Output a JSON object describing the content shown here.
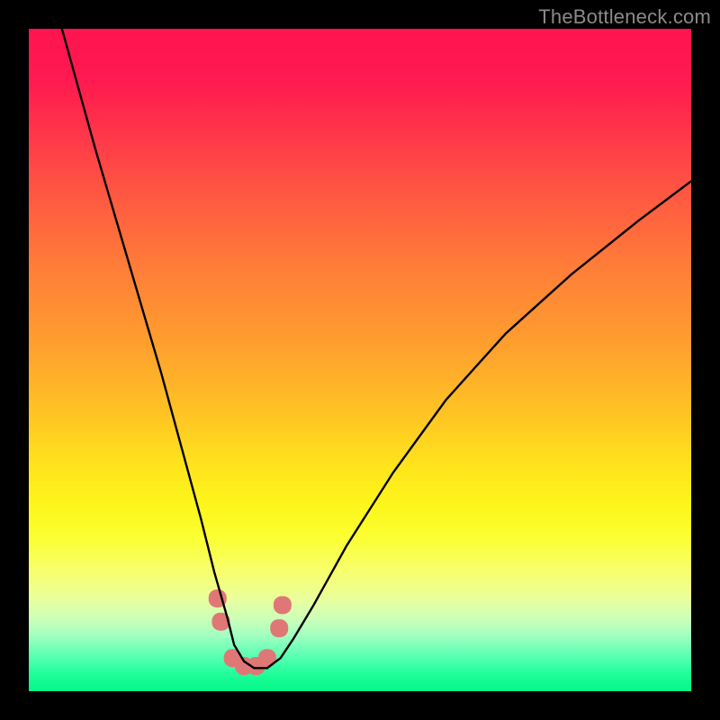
{
  "watermark": {
    "text": "TheBottleneck.com"
  },
  "chart_data": {
    "type": "line",
    "title": "",
    "xlabel": "",
    "ylabel": "",
    "x_range": [
      0,
      100
    ],
    "y_range": [
      0,
      100
    ],
    "grid": false,
    "legend": false,
    "background": {
      "kind": "vertical_gradient",
      "stops": [
        {
          "pct": 0,
          "color": "#ff1450"
        },
        {
          "pct": 50,
          "color": "#ffbd26"
        },
        {
          "pct": 75,
          "color": "#fbff34"
        },
        {
          "pct": 100,
          "color": "#07f78b"
        }
      ]
    },
    "series": [
      {
        "name": "bottleneck_curve",
        "color": "#000000",
        "x": [
          5,
          10,
          15,
          20,
          23,
          26,
          28,
          30,
          31,
          32.5,
          34,
          36,
          38,
          40,
          43,
          48,
          55,
          63,
          72,
          82,
          92,
          100
        ],
        "y": [
          100,
          82,
          65,
          48,
          37,
          26,
          18,
          11,
          7,
          4.5,
          3.5,
          3.5,
          5,
          8,
          13,
          22,
          33,
          44,
          54,
          63,
          71,
          77
        ]
      }
    ],
    "markers": {
      "name": "highlight_points",
      "color": "#e07777",
      "shape": "rounded",
      "x": [
        28.5,
        29.0,
        30.8,
        32.5,
        34.3,
        36.0,
        37.8,
        38.3
      ],
      "y": [
        14.0,
        10.5,
        5.0,
        3.8,
        3.8,
        5.0,
        9.5,
        13.0
      ]
    }
  }
}
